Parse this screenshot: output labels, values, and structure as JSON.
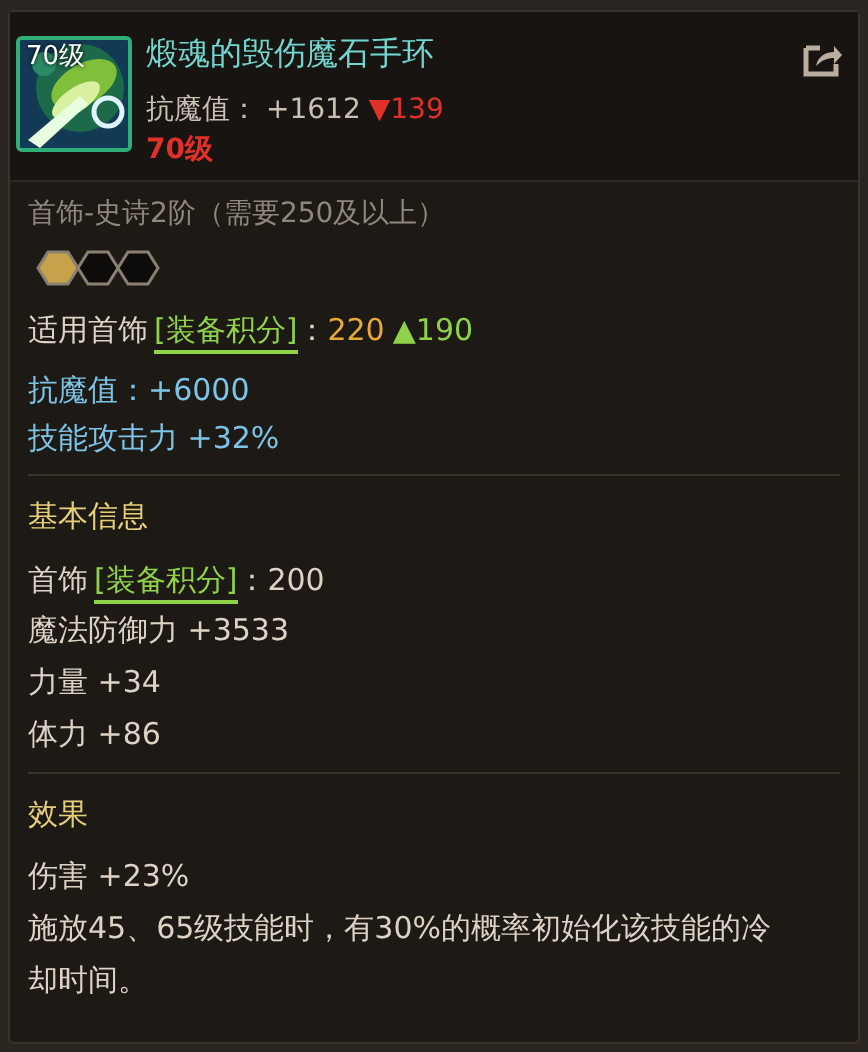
{
  "header": {
    "item_icon": {
      "level_badge": "70级"
    },
    "title": "煅魂的毁伤魔石手环",
    "stat": {
      "label": "抗魔值：",
      "value": "+1612",
      "delta": "▼139"
    },
    "level": "70级"
  },
  "subtitle": "首饰-史诗2阶（需要250及以上）",
  "sockets": [
    {
      "filled": true
    },
    {
      "filled": false
    },
    {
      "filled": false
    }
  ],
  "score_line": {
    "label": "适用首饰",
    "tag": "[装备积分]",
    "colon": "：",
    "value": "220",
    "delta": "▲190"
  },
  "bonuses": [
    "抗魔值：+6000",
    "技能攻击力 +32%"
  ],
  "basic_info": {
    "heading": "基本信息",
    "score_line": {
      "label": "首饰",
      "tag": "[装备积分]",
      "colon": "：",
      "value": "200"
    },
    "stats": [
      "魔法防御力 +3533",
      "力量 +34",
      "体力 +86"
    ]
  },
  "effects": {
    "heading": "效果",
    "lines": [
      "伤害 +23%",
      "施放45、65级技能时，有30%的概率初始化该技能的冷却时间。"
    ]
  }
}
